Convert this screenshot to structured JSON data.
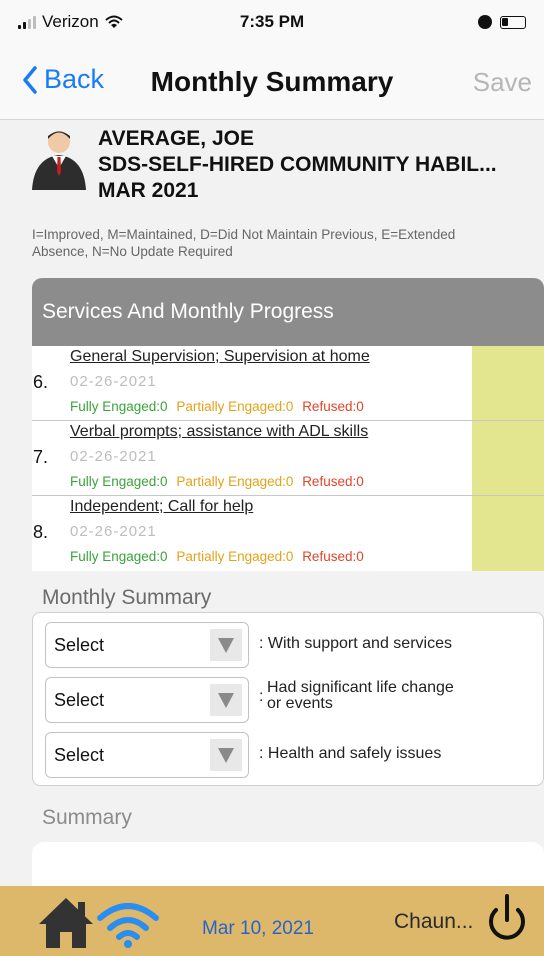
{
  "status_bar": {
    "carrier": "Verizon",
    "time": "7:35 PM"
  },
  "nav": {
    "back_label": "Back",
    "title": "Monthly Summary",
    "save_label": "Save"
  },
  "patient": {
    "name": "AVERAGE, JOE",
    "program": "SDS-SELF-HIRED COMMUNITY HABIL...",
    "period": "MAR 2021"
  },
  "legend": "I=Improved, M=Maintained, D=Did Not Maintain Previous, E=Extended Absence, N=No Update Required",
  "services": {
    "header": "Services And Monthly Progress",
    "items": [
      {
        "num": "6.",
        "name": "General Supervision; Supervision at home",
        "date": "02-26-2021",
        "fully": "Fully Engaged:0",
        "partially": "Partially Engaged:0",
        "refused": "Refused:0"
      },
      {
        "num": "7.",
        "name": "Verbal prompts; assistance with ADL skills",
        "date": "02-26-2021",
        "fully": "Fully Engaged:0",
        "partially": "Partially Engaged:0",
        "refused": "Refused:0"
      },
      {
        "num": "8.",
        "name": "Independent; Call for help",
        "date": "02-26-2021",
        "fully": "Fully Engaged:0",
        "partially": "Partially Engaged:0",
        "refused": "Refused:0"
      }
    ]
  },
  "monthly_summary": {
    "label": "Monthly Summary",
    "rows": [
      {
        "value": "Select",
        "text": ": With support and services"
      },
      {
        "value": "Select",
        "text_colon": ":",
        "text_line1": "Had significant life change",
        "text_line2": "or events"
      },
      {
        "value": "Select",
        "text": ": Health and safely issues"
      }
    ]
  },
  "summary": {
    "label": "Summary",
    "value": ""
  },
  "footer": {
    "date": "Mar 10, 2021",
    "user": "Chaun..."
  },
  "colors": {
    "accent": "#1a7cf5",
    "footer_bg": "#ddb86a",
    "section_header": "#8c8c8c",
    "progress_bar": "#e3e68f",
    "fully": "#3aa43a",
    "partially": "#e3a21a",
    "refused": "#e0452b"
  }
}
